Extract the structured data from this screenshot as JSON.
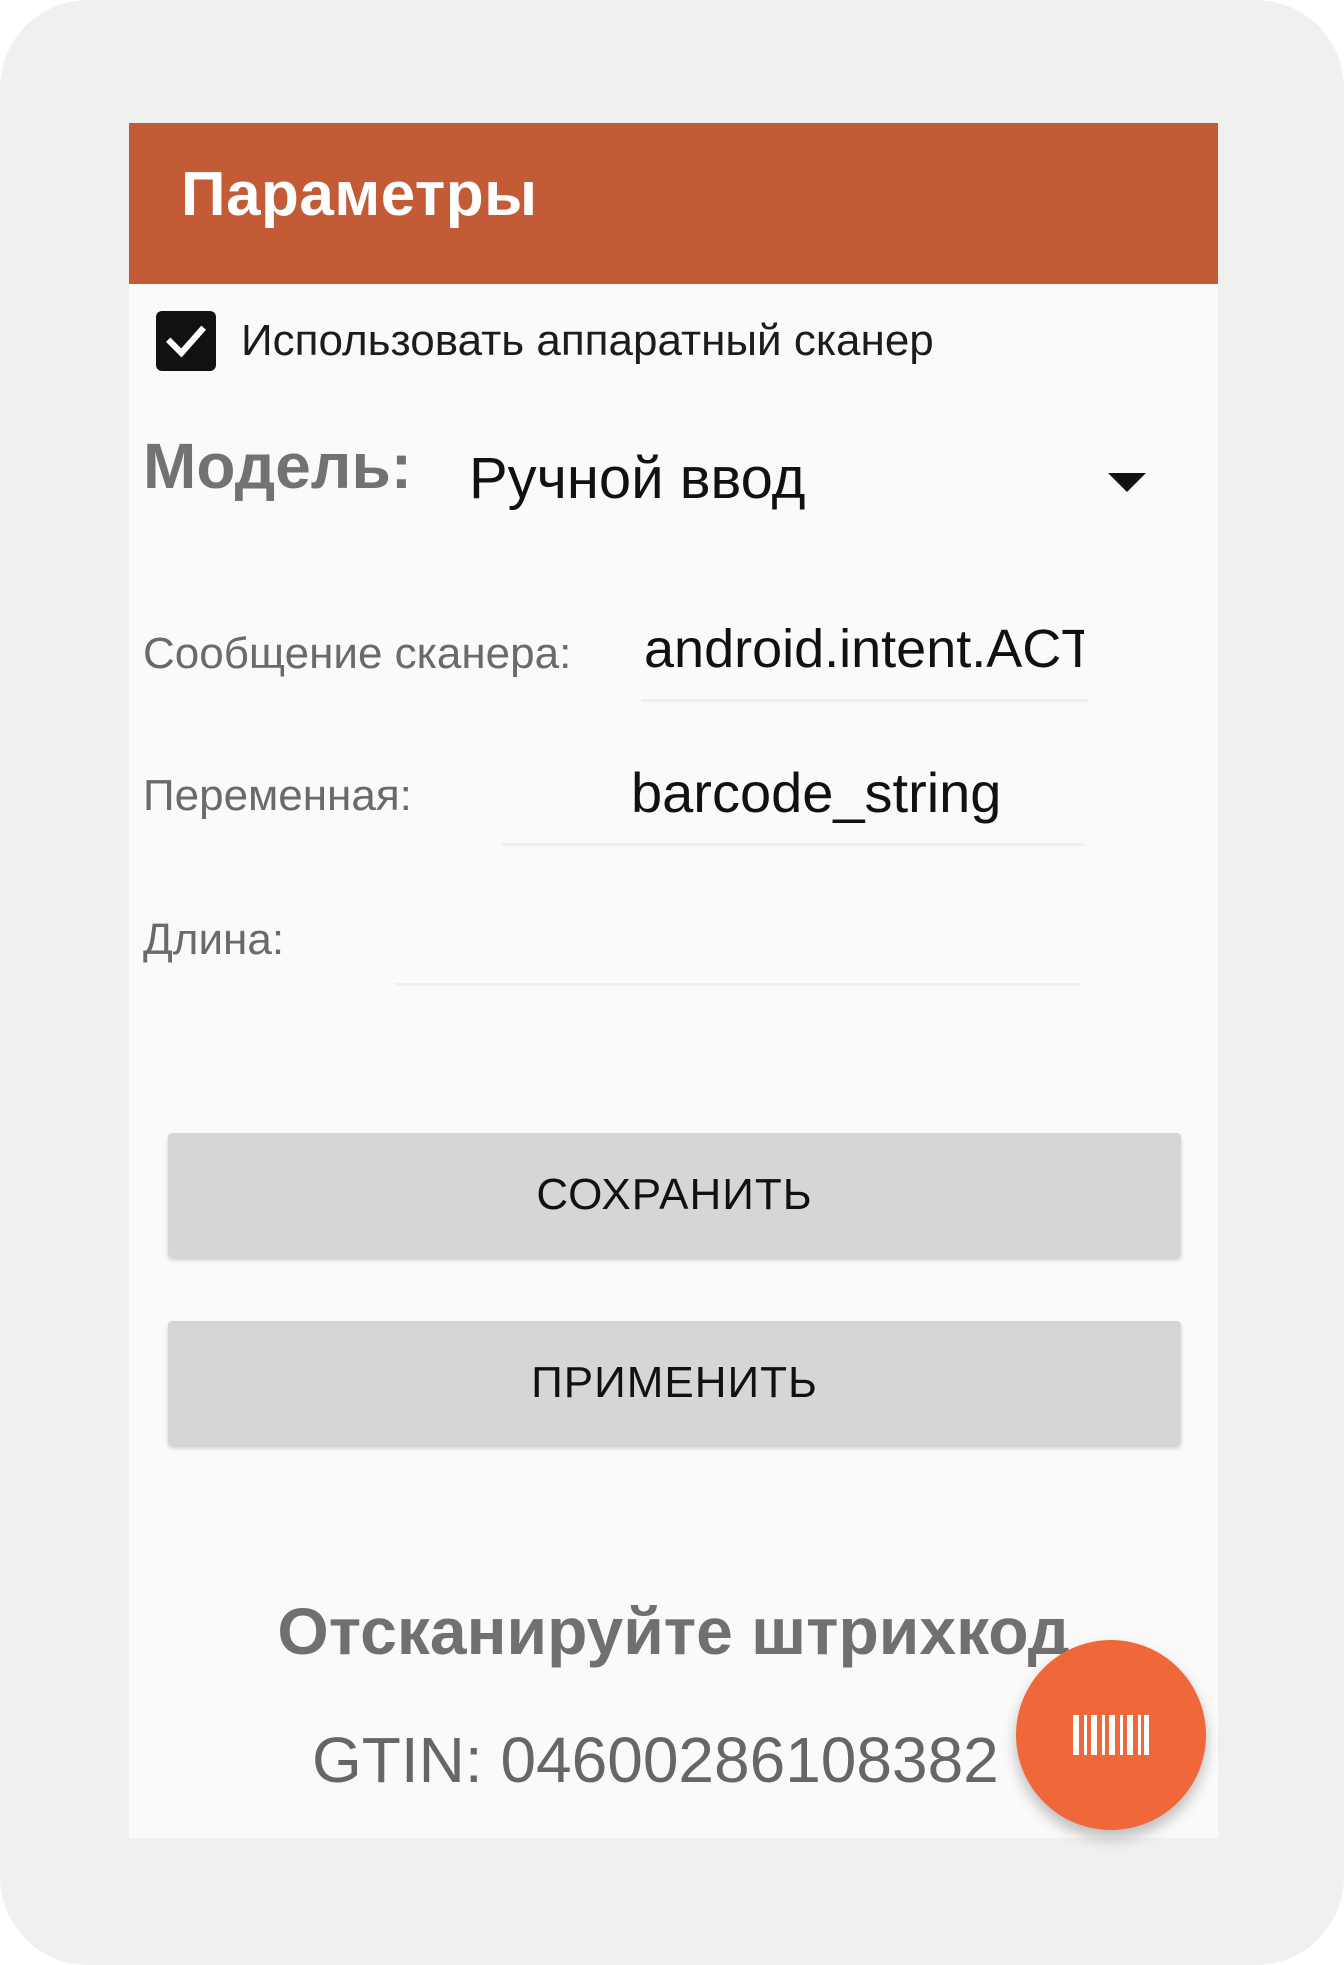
{
  "app_bar": {
    "title": "Параметры"
  },
  "hardware_scanner": {
    "label": "Использовать аппаратный сканер",
    "checked": true
  },
  "model": {
    "label": "Модель:",
    "selected": "Ручной ввод"
  },
  "scanner_message": {
    "label": "Сообщение сканера:",
    "value": "android.intent.ACTIO"
  },
  "variable": {
    "label": "Переменная:",
    "value": "barcode_string"
  },
  "length": {
    "label": "Длина:",
    "value": ""
  },
  "buttons": {
    "save": "СОХРАНИТЬ",
    "apply": "ПРИМЕНИТЬ"
  },
  "scan": {
    "prompt": "Отсканируйте штрихкод",
    "gtin": "GTIN: 04600286108382"
  },
  "fab": {
    "icon": "barcode-icon"
  },
  "colors": {
    "app_bar": "#c25b36",
    "fab": "#f0683a",
    "button": "#d6d6d6"
  }
}
